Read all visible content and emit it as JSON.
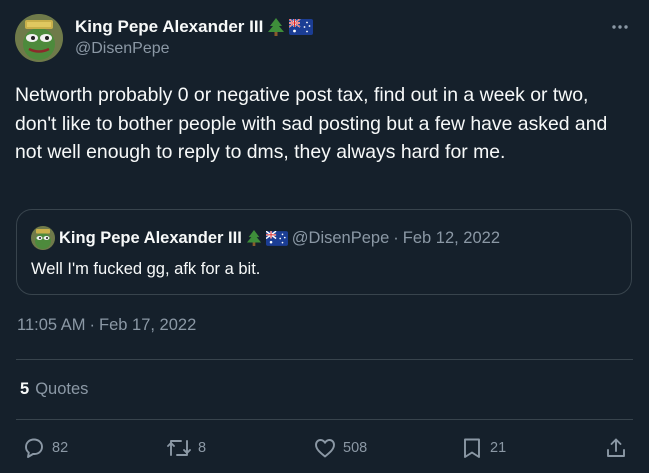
{
  "header": {
    "display_name": "King Pepe Alexander III",
    "handle": "@DisenPepe",
    "name_emojis": [
      "tree-emoji",
      "australia-flag-emoji"
    ]
  },
  "tweet": {
    "text": "Networth probably 0 or negative post tax, find out in a week or two, don't like to bother people with sad posting but a few have asked and not well enough to reply to dms, they always hard for me."
  },
  "quote": {
    "display_name": "King Pepe Alexander III",
    "handle": "@DisenPepe",
    "separator": "·",
    "date": "Feb 12, 2022",
    "text": "Well I'm fucked gg, afk for a bit."
  },
  "timestamp": {
    "time": "11:05 AM",
    "separator": "·",
    "date": "Feb 17, 2022"
  },
  "stats": {
    "quotes_count": "5",
    "quotes_label": "Quotes"
  },
  "actions": {
    "replies": "82",
    "retweets": "8",
    "likes": "508",
    "bookmarks": "21"
  },
  "colors": {
    "background": "#15202b",
    "text": "#f7f9f9",
    "secondary": "#8b98a5",
    "border": "#38444d"
  }
}
